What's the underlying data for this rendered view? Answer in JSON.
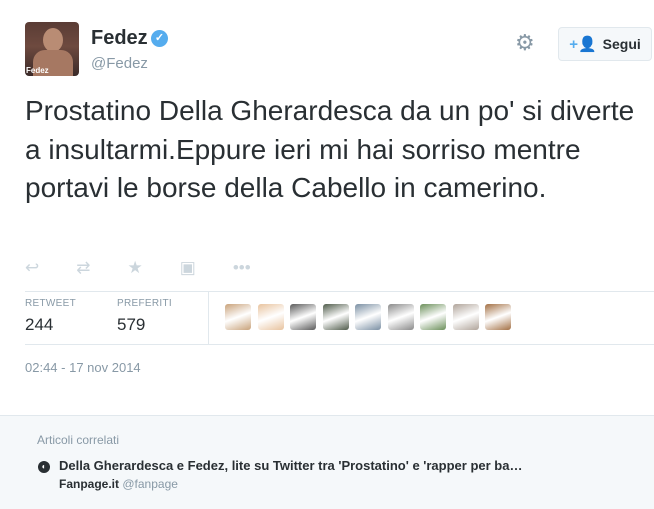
{
  "user": {
    "name": "Fedez",
    "handle": "@Fedez",
    "avatar_tag": "Fedez"
  },
  "follow_button": {
    "label": "Segui"
  },
  "tweet": {
    "text": "Prostatino Della Gherardesca da un po' si diverte a insultarmi.Eppure ieri mi hai sorriso mentre portavi le borse della Cabello in camerino."
  },
  "actions": [
    {
      "name": "reply-icon",
      "glyph": "↩"
    },
    {
      "name": "retweet-icon",
      "glyph": "⇄"
    },
    {
      "name": "favorite-icon",
      "glyph": "★"
    },
    {
      "name": "media-icon",
      "glyph": "▣"
    },
    {
      "name": "more-icon",
      "glyph": "•••"
    }
  ],
  "stats": {
    "retweet_label": "RETWEET",
    "retweet_count": "244",
    "favorites_label": "PREFERITI",
    "favorites_count": "579"
  },
  "favoriter_colors": [
    "#c9a27a",
    "#e8c39e",
    "#5a5a5a",
    "#4f5b4a",
    "#7a8fa3",
    "#8a8a8a",
    "#6b8f5a",
    "#b0a49a",
    "#a37044"
  ],
  "timestamp": "02:44 - 17 nov 2014",
  "related": {
    "title": "Articoli correlati",
    "headline": "Della Gherardesca e Fedez, lite su Twitter tra 'Prostatino' e 'rapper per ba…",
    "source_name": "Fanpage.it",
    "source_handle": "@fanpage"
  },
  "colors": {
    "text": "#292f33",
    "muted": "#8899a6",
    "accent": "#55acee",
    "border": "#e1e8ed"
  }
}
